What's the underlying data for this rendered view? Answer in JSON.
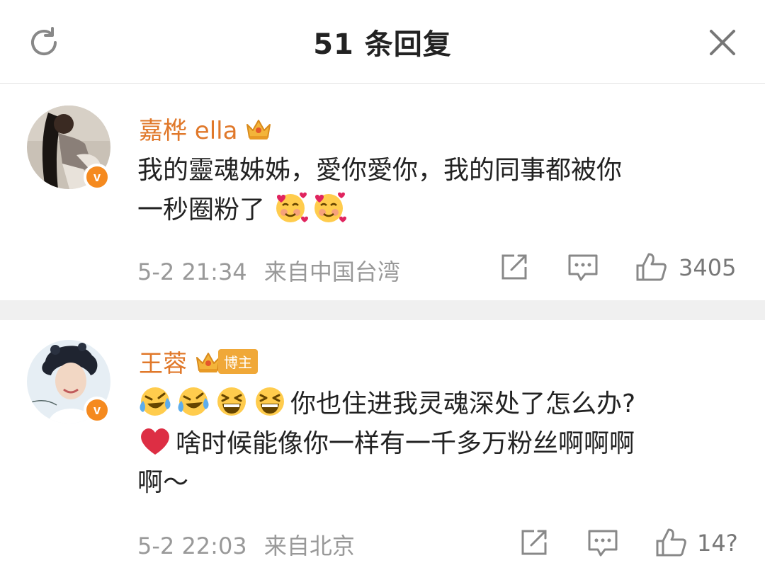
{
  "header": {
    "title": "51 条回复",
    "refresh_icon": "refresh-icon",
    "close_icon": "close-icon"
  },
  "comments": [
    {
      "username": "嘉桦 ella",
      "badge_icon": "crown-icon",
      "text_line1": "我的靈魂姊姊，愛你愛你，我的同事都被你",
      "text_line2": "一秒圈粉了",
      "emojis": [
        "smiling-face-with-hearts",
        "smiling-face-with-hearts"
      ],
      "time": "5-2 21:34",
      "location": "来自中国台湾",
      "likes": "3405"
    },
    {
      "username": "王蓉",
      "badge_icon": "crown-icon",
      "badge_label": "博主",
      "emojis": [
        "loudly-crying-laughing",
        "loudly-crying-laughing",
        "grinning-squint",
        "grinning-squint"
      ],
      "text_line1": "你也住进我灵魂深处了怎么办?",
      "heart_icon": "red-heart",
      "text_line2": "啥时候能像你一样有一千多万粉丝啊啊啊",
      "text_line3": "啊～",
      "time": "5-2 22:03",
      "location": "来自北京",
      "likes": "14?"
    }
  ],
  "colors": {
    "username": "#e0782a",
    "verified": "#f58a1f",
    "meta": "#999999",
    "separator": "#f0f0f0"
  }
}
